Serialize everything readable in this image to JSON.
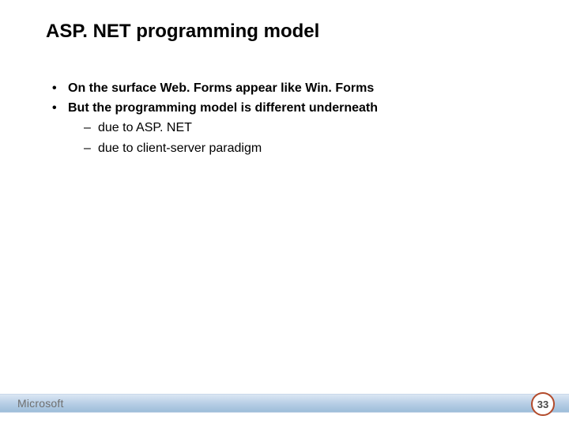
{
  "title": "ASP. NET programming model",
  "bullets": [
    {
      "level": 1,
      "text": "On the surface Web. Forms appear like Win. Forms"
    },
    {
      "level": 1,
      "text": "But the programming model is different underneath"
    },
    {
      "level": 2,
      "text": "due to ASP. NET"
    },
    {
      "level": 2,
      "text": "due to client-server paradigm"
    }
  ],
  "footer": {
    "logo": "Microsoft",
    "page_number": "33"
  },
  "colors": {
    "accent_ring": "#b34b2b",
    "footer_gradient_top": "#dbe6f3",
    "footer_gradient_bottom": "#9dbdd9"
  }
}
